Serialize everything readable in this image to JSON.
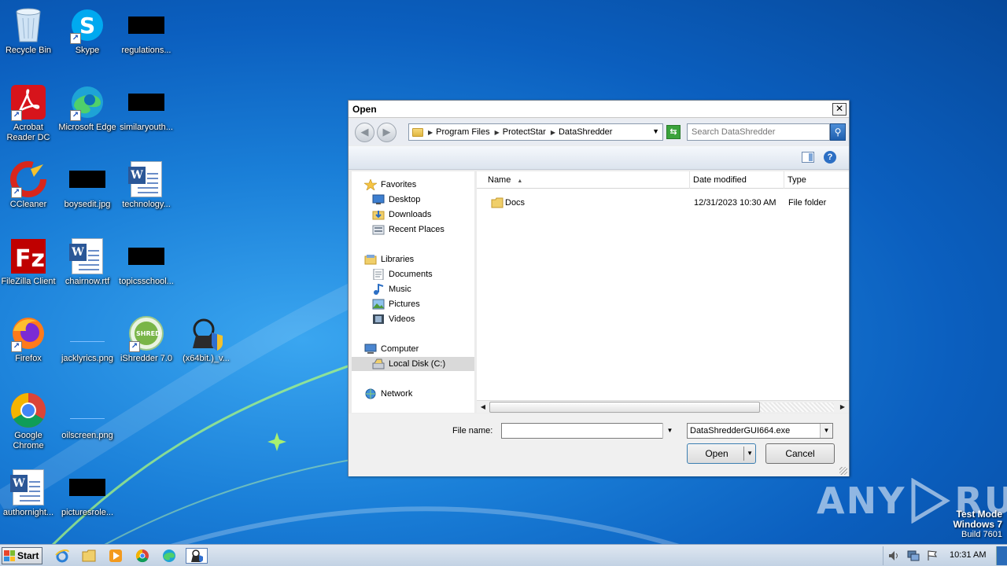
{
  "desktop": {
    "icons": [
      {
        "label": "Recycle Bin"
      },
      {
        "label": "Skype"
      },
      {
        "label": "regulations..."
      },
      {
        "label": "Acrobat Reader DC"
      },
      {
        "label": "Microsoft Edge"
      },
      {
        "label": "similaryouth..."
      },
      {
        "label": "CCleaner"
      },
      {
        "label": "boysedit.jpg"
      },
      {
        "label": "technology..."
      },
      {
        "label": "FileZilla Client"
      },
      {
        "label": "chairnow.rtf"
      },
      {
        "label": "topicsschool..."
      },
      {
        "label": "Firefox"
      },
      {
        "label": "jacklyrics.png"
      },
      {
        "label": "iShredder 7.0"
      },
      {
        "label": "(x64bit.)_v..."
      },
      {
        "label": "Google Chrome"
      },
      {
        "label": "oilscreen.png"
      },
      {
        "label": "authornight..."
      },
      {
        "label": "picturesrole..."
      }
    ]
  },
  "dialog": {
    "title": "Open",
    "close": "✕",
    "breadcrumbs": [
      "Program Files",
      "ProtectStar",
      "DataShredder"
    ],
    "search_placeholder": "Search DataShredder",
    "nav": {
      "favorites_header": "Favorites",
      "favorites": [
        "Desktop",
        "Downloads",
        "Recent Places"
      ],
      "libraries_header": "Libraries",
      "libraries": [
        "Documents",
        "Music",
        "Pictures",
        "Videos"
      ],
      "computer_header": "Computer",
      "computer": [
        "Local Disk (C:)"
      ],
      "network": "Network"
    },
    "columns": {
      "name": "Name",
      "date": "Date modified",
      "type": "Type"
    },
    "files": [
      {
        "name": "Docs",
        "date": "12/31/2023 10:30 AM",
        "type": "File folder"
      }
    ],
    "file_name_label": "File name:",
    "file_name_value": "",
    "file_type_value": "DataShredderGUI664.exe",
    "open_label": "Open",
    "cancel_label": "Cancel"
  },
  "watermark": {
    "left": "ANY",
    "right": "RUN"
  },
  "test_mode": {
    "line1": "Test Mode",
    "line2": "Windows 7",
    "line3": "Build 7601"
  },
  "taskbar": {
    "start_label": "Start",
    "clock": "10:31 AM"
  },
  "colors": {
    "desktop_bg": "#1a7fd8",
    "taskbar": "#c2d2e4",
    "selection": "#d9d9d9"
  }
}
